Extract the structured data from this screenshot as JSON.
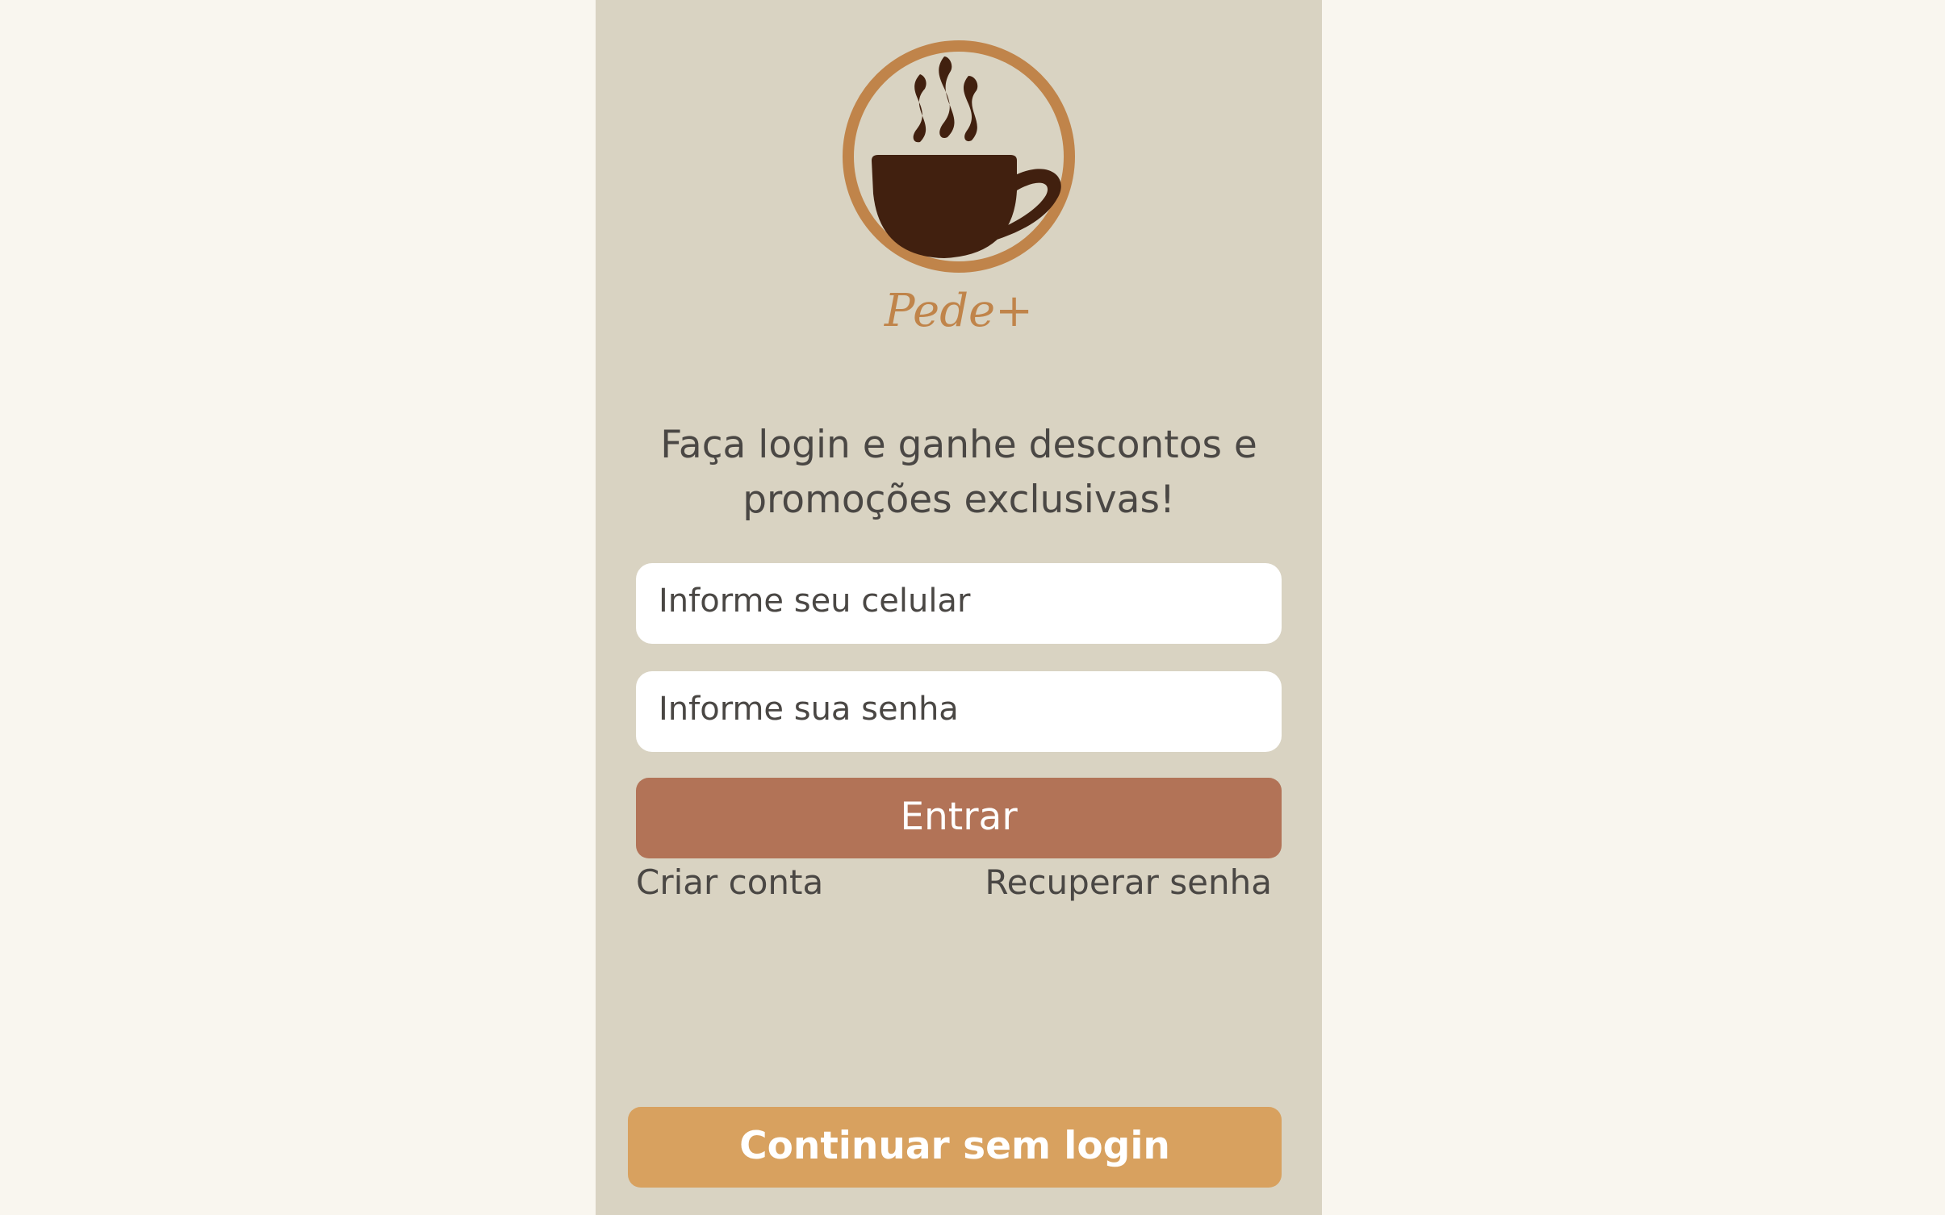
{
  "brand": {
    "name": "Pede+",
    "logo_icon": "coffee-cup-icon",
    "colors": {
      "ring": "#c0844a",
      "cup": "#41200f",
      "wordmark": "#c0844a"
    }
  },
  "login": {
    "headline": "Faça login e ganhe descontos e promoções exclusivas!",
    "phone_placeholder": "Informe seu celular",
    "password_placeholder": "Informe sua senha",
    "submit_label": "Entrar",
    "create_account_label": "Criar conta",
    "recover_password_label": "Recuperar senha",
    "guest_label": "Continuar sem login"
  },
  "colors": {
    "page_background": "#f9f6ef",
    "panel_background": "#d9d3c2",
    "primary_button": "#b27357",
    "secondary_button": "#d8a15f",
    "text": "#4a4744"
  }
}
